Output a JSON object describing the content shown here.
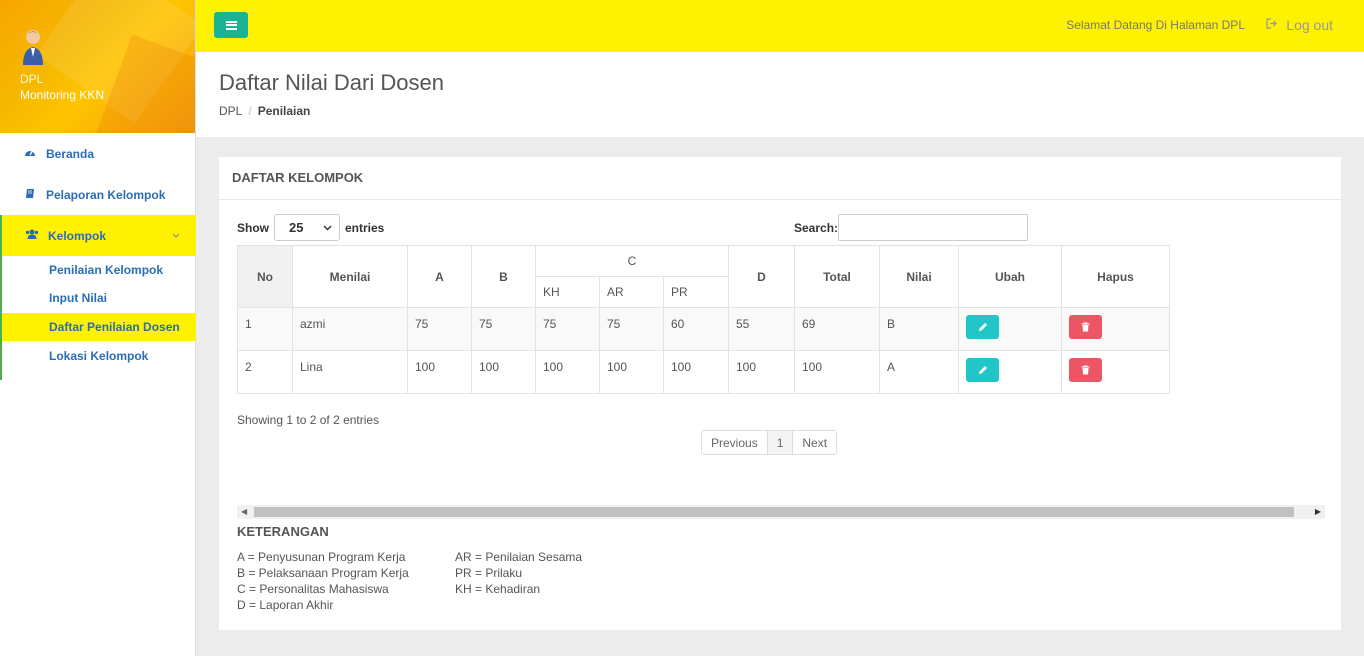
{
  "sidebar": {
    "role": "DPL",
    "app_name": "Monitoring KKN",
    "items": [
      {
        "label": "Beranda",
        "icon": "dashboard-icon"
      },
      {
        "label": "Pelaporan Kelompok",
        "icon": "book-icon"
      },
      {
        "label": "Kelompok",
        "icon": "users-icon"
      }
    ],
    "sub_items": [
      {
        "label": "Penilaian Kelompok"
      },
      {
        "label": "Input Nilai"
      },
      {
        "label": "Daftar Penilaian Dosen"
      },
      {
        "label": "Lokasi Kelompok"
      }
    ]
  },
  "topbar": {
    "welcome": "Selamat Datang Di Halaman DPL",
    "logout": "Log out"
  },
  "heading": {
    "title": "Daftar Nilai Dari Dosen",
    "breadcrumb": [
      "DPL",
      "Penilaian"
    ]
  },
  "panel": {
    "title": "DAFTAR KELOMPOK",
    "show_label": "Show",
    "entries_value": "25",
    "entries_label": "entries",
    "search_label": "Search:",
    "search_value": "",
    "columns": {
      "no": "No",
      "menilai": "Menilai",
      "a": "A",
      "b": "B",
      "c": "C",
      "c_sub": [
        "KH",
        "AR",
        "PR"
      ],
      "d": "D",
      "total": "Total",
      "nilai": "Nilai",
      "ubah": "Ubah",
      "hapus": "Hapus"
    },
    "rows": [
      {
        "no": "1",
        "menilai": "azmi",
        "a": "75",
        "b": "75",
        "kh": "75",
        "ar": "75",
        "pr": "60",
        "d": "55",
        "total": "69",
        "nilai": "B"
      },
      {
        "no": "2",
        "menilai": "Lina",
        "a": "100",
        "b": "100",
        "kh": "100",
        "ar": "100",
        "pr": "100",
        "d": "100",
        "total": "100",
        "nilai": "A"
      }
    ],
    "info": "Showing 1 to 2 of 2 entries",
    "pagination": {
      "previous": "Previous",
      "page": "1",
      "next": "Next"
    },
    "legend_title": "KETERANGAN",
    "legend_left": [
      "A = Penyusunan Program Kerja",
      "B = Pelaksanaan Program Kerja",
      "C = Personalitas Mahasiswa",
      "D = Laporan Akhir"
    ],
    "legend_right": [
      "AR = Penilaian Sesama",
      "PR = Prilaku",
      "KH = Kehadiran"
    ]
  },
  "colors": {
    "accent_yellow": "#fff200",
    "menu_button": "#1ab394",
    "link_blue": "#2a6db5",
    "edit_button": "#23c6c8",
    "delete_button": "#ed5565"
  }
}
